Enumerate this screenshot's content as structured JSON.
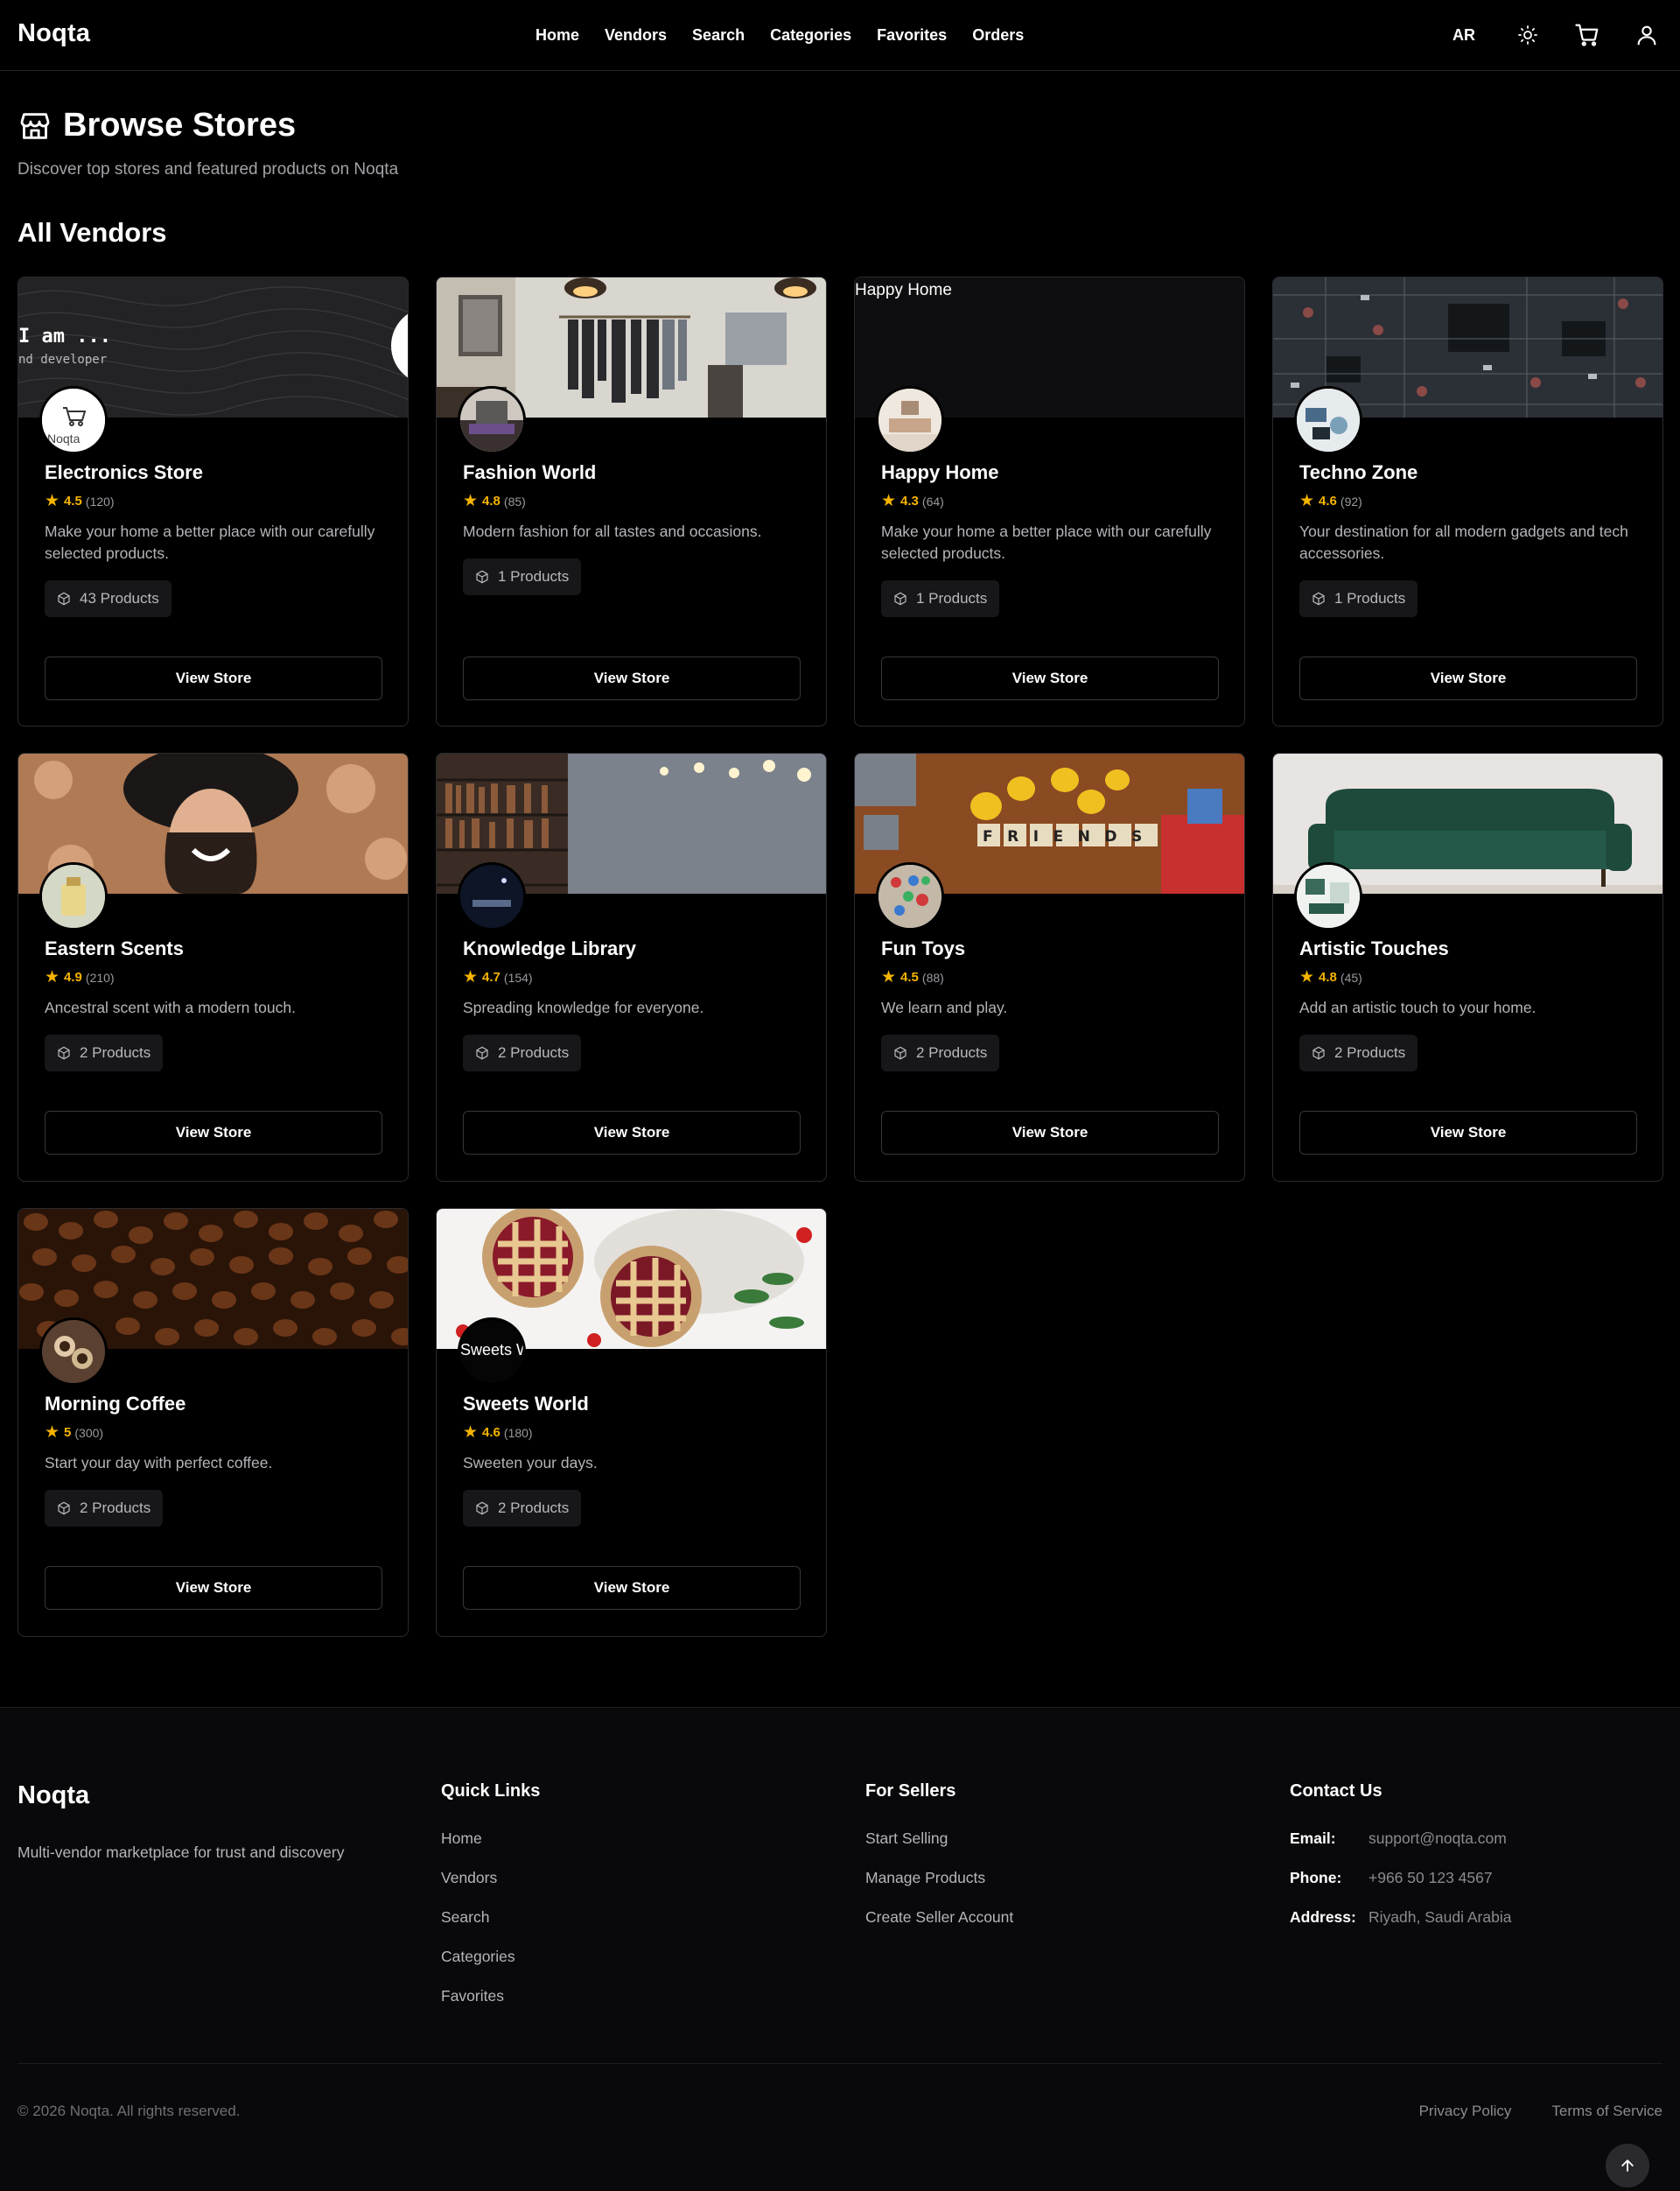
{
  "nav": {
    "brand": "Noqta",
    "links": [
      "Home",
      "Vendors",
      "Search",
      "Categories",
      "Favorites",
      "Orders"
    ],
    "lang": "AR"
  },
  "header": {
    "title": "Browse Stores",
    "subtitle": "Discover top stores and featured products on Noqta"
  },
  "section_title": "All Vendors",
  "view_label": "View Store",
  "vendors": [
    {
      "name": "Electronics Store",
      "rating": "4.5",
      "count": "(120)",
      "desc": "Make your home a better place with our carefully selected products.",
      "products": "43 Products"
    },
    {
      "name": "Fashion World",
      "rating": "4.8",
      "count": "(85)",
      "desc": "Modern fashion for all tastes and occasions.",
      "products": "1 Products"
    },
    {
      "name": "Happy Home",
      "rating": "4.3",
      "count": "(64)",
      "desc": "Make your home a better place with our carefully selected products.",
      "products": "1 Products",
      "cover_alt": "Happy Home"
    },
    {
      "name": "Techno Zone",
      "rating": "4.6",
      "count": "(92)",
      "desc": "Your destination for all modern gadgets and tech accessories.",
      "products": "1 Products"
    },
    {
      "name": "Eastern Scents",
      "rating": "4.9",
      "count": "(210)",
      "desc": "Ancestral scent with a modern touch.",
      "products": "2 Products"
    },
    {
      "name": "Knowledge Library",
      "rating": "4.7",
      "count": "(154)",
      "desc": "Spreading knowledge for everyone.",
      "products": "2 Products"
    },
    {
      "name": "Fun Toys",
      "rating": "4.5",
      "count": "(88)",
      "desc": "We learn and play.",
      "products": "2 Products"
    },
    {
      "name": "Artistic Touches",
      "rating": "4.8",
      "count": "(45)",
      "desc": "Add an artistic touch to your home.",
      "products": "2 Products"
    },
    {
      "name": "Morning Coffee",
      "rating": "5",
      "count": "(300)",
      "desc": "Start your day with perfect coffee.",
      "products": "2 Products"
    },
    {
      "name": "Sweets World",
      "rating": "4.6",
      "count": "(180)",
      "desc": "Sweeten your days.",
      "products": "2 Products",
      "avatar_alt": "Sweets World"
    }
  ],
  "footer": {
    "brand": "Noqta",
    "tagline": "Multi-vendor marketplace for trust and discovery",
    "quick_links_title": "Quick Links",
    "quick_links": [
      "Home",
      "Vendors",
      "Search",
      "Categories",
      "Favorites"
    ],
    "sellers_title": "For Sellers",
    "sellers_links": [
      "Start Selling",
      "Manage Products",
      "Create Seller Account"
    ],
    "contact_title": "Contact Us",
    "contact": [
      {
        "label": "Email:",
        "value": "support@noqta.com"
      },
      {
        "label": "Phone:",
        "value": "+966 50 123 4567"
      },
      {
        "label": "Address:",
        "value": "Riyadh, Saudi Arabia"
      }
    ],
    "copyright": "© 2026 Noqta. All rights reserved.",
    "legal": [
      "Privacy Policy",
      "Terms of Service"
    ]
  },
  "colors": {
    "accent_star": "#f5b400",
    "background": "#000000",
    "card_border": "#2b2b30"
  },
  "icons": [
    "store-icon",
    "sun-icon",
    "cart-icon",
    "user-icon",
    "package-icon",
    "star-icon",
    "arrow-up-icon"
  ]
}
